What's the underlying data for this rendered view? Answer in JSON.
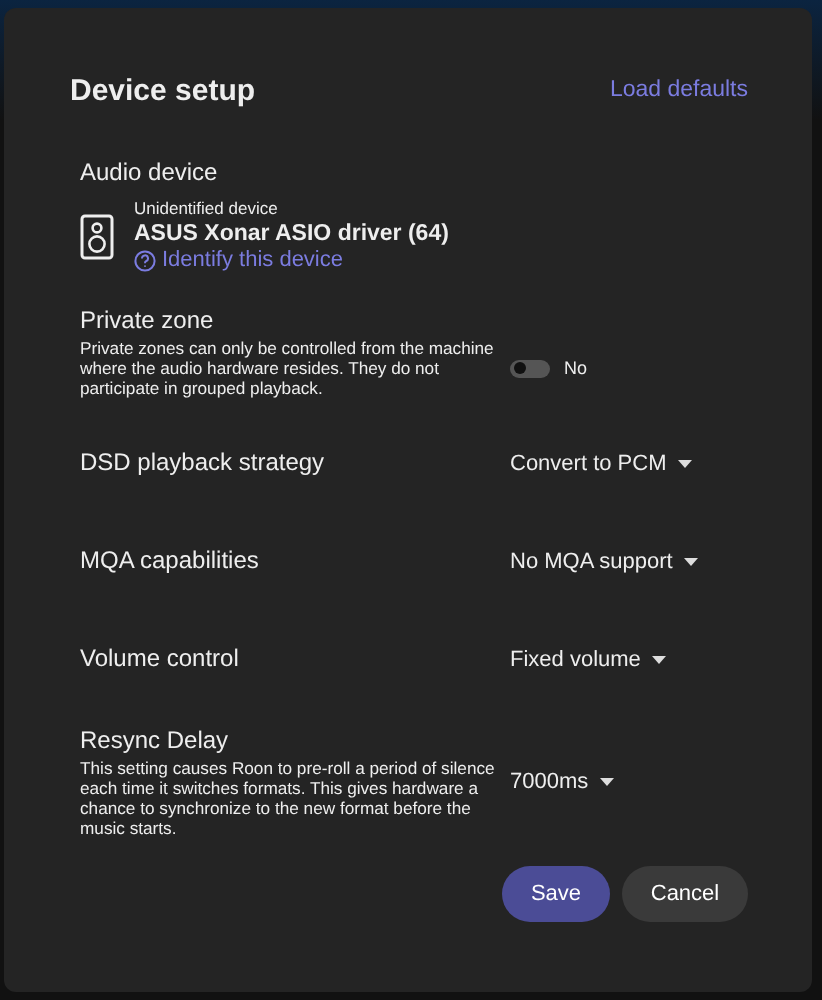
{
  "dialog": {
    "title": "Device setup",
    "load_defaults": "Load defaults",
    "audio_device": {
      "label": "Audio device",
      "status": "Unidentified device",
      "name": "ASUS Xonar ASIO driver (64)",
      "identify_link": "Identify this device"
    },
    "private_zone": {
      "label": "Private zone",
      "description": "Private zones can only be controlled from the machine where the audio hardware resides. They do not participate in grouped playback.",
      "on": false,
      "value": "No"
    },
    "settings": [
      {
        "label": "DSD playback strategy",
        "value": "Convert to PCM"
      },
      {
        "label": "MQA capabilities",
        "value": "No MQA support"
      },
      {
        "label": "Volume control",
        "value": "Fixed volume"
      },
      {
        "label": "Resync Delay",
        "description": "This setting causes Roon to pre-roll a period of silence each time it switches formats. This gives hardware a chance to synchronize to the new format before the music starts.",
        "value": "7000ms"
      }
    ],
    "buttons": [
      {
        "label": "Save",
        "kind": "primary"
      },
      {
        "label": "Cancel",
        "kind": "secondary"
      }
    ]
  }
}
